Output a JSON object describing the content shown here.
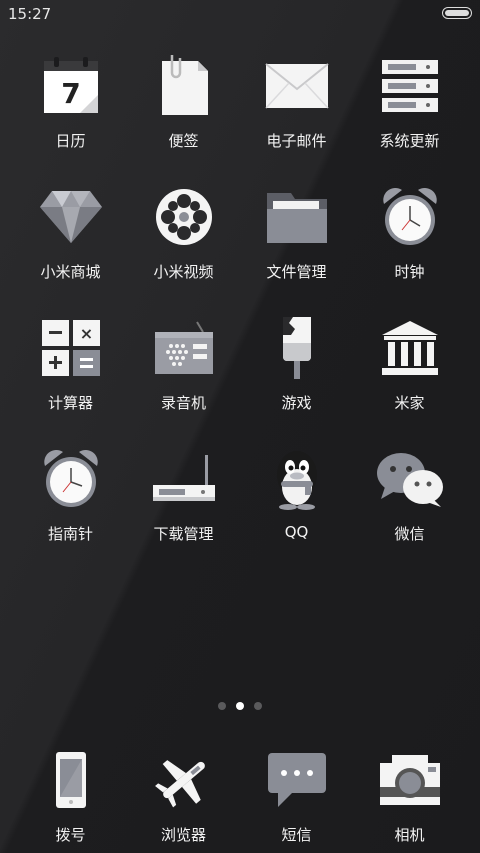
{
  "status": {
    "time": "15:27"
  },
  "apps": [
    {
      "label": "日历",
      "icon": "calendar-icon",
      "date": "7"
    },
    {
      "label": "便签",
      "icon": "notes-icon"
    },
    {
      "label": "电子邮件",
      "icon": "email-icon"
    },
    {
      "label": "系统更新",
      "icon": "system-update-icon"
    },
    {
      "label": "小米商城",
      "icon": "diamond-icon"
    },
    {
      "label": "小米视频",
      "icon": "film-reel-icon"
    },
    {
      "label": "文件管理",
      "icon": "folder-icon"
    },
    {
      "label": "时钟",
      "icon": "alarm-clock-icon"
    },
    {
      "label": "计算器",
      "icon": "calculator-icon"
    },
    {
      "label": "录音机",
      "icon": "radio-recorder-icon"
    },
    {
      "label": "游戏",
      "icon": "popsicle-icon"
    },
    {
      "label": "米家",
      "icon": "building-icon"
    },
    {
      "label": "指南针",
      "icon": "compass-clock-icon"
    },
    {
      "label": "下载管理",
      "icon": "router-icon"
    },
    {
      "label": "QQ",
      "icon": "penguin-icon"
    },
    {
      "label": "微信",
      "icon": "chat-bubbles-icon"
    }
  ],
  "page_indicator": {
    "count": 3,
    "active": 2
  },
  "dock": [
    {
      "label": "拨号",
      "icon": "phone-icon"
    },
    {
      "label": "浏览器",
      "icon": "airplane-icon"
    },
    {
      "label": "短信",
      "icon": "message-bubble-icon"
    },
    {
      "label": "相机",
      "icon": "camera-icon"
    }
  ]
}
